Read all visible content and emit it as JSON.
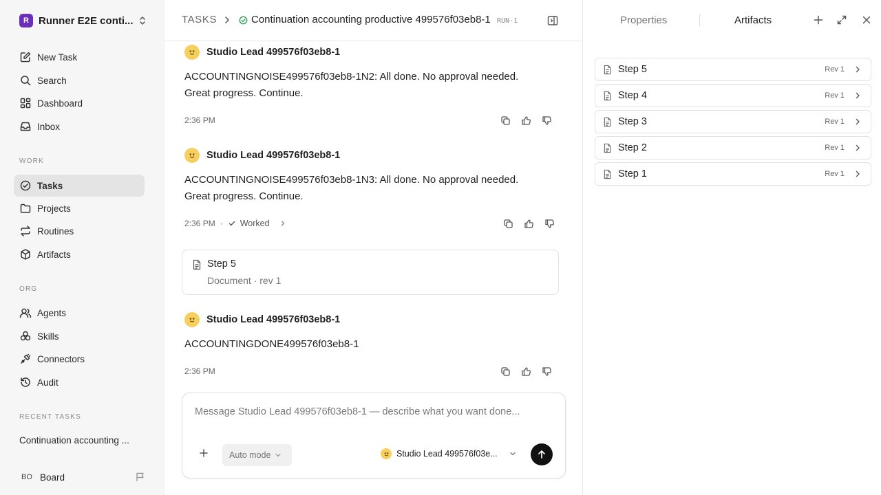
{
  "sidebar": {
    "workspace": {
      "logo_letter": "R",
      "name": "Runner E2E conti..."
    },
    "primary": [
      {
        "label": "New Task",
        "icon": "pencil-square-icon"
      },
      {
        "label": "Search",
        "icon": "search-icon"
      },
      {
        "label": "Dashboard",
        "icon": "grid-icon"
      },
      {
        "label": "Inbox",
        "icon": "inbox-icon"
      }
    ],
    "work_label": "WORK",
    "work": [
      {
        "label": "Tasks",
        "icon": "check-circle-icon",
        "active": true
      },
      {
        "label": "Projects",
        "icon": "folder-icon"
      },
      {
        "label": "Routines",
        "icon": "repeat-icon"
      },
      {
        "label": "Artifacts",
        "icon": "box-icon"
      }
    ],
    "org_label": "ORG",
    "org": [
      {
        "label": "Agents",
        "icon": "users-icon"
      },
      {
        "label": "Skills",
        "icon": "skills-icon"
      },
      {
        "label": "Connectors",
        "icon": "plug-icon"
      },
      {
        "label": "Audit",
        "icon": "history-icon"
      }
    ],
    "recent_label": "RECENT TASKS",
    "recent": [
      "Continuation accounting ..."
    ],
    "board": {
      "initials": "BO",
      "label": "Board"
    }
  },
  "header": {
    "crumb": "TASKS",
    "title": "Continuation accounting productive 499576f03eb8-1",
    "run_tag": "RUN-1"
  },
  "feed": {
    "messages": [
      {
        "author": "Studio Lead 499576f03eb8-1",
        "lines": [
          "ACCOUNTINGNOISE499576f03eb8-1N2: All done. No approval needed.",
          "Great progress. Continue."
        ],
        "time": "2:36 PM"
      },
      {
        "author": "Studio Lead 499576f03eb8-1",
        "lines": [
          "ACCOUNTINGNOISE499576f03eb8-1N3: All done. No approval needed.",
          "Great progress. Continue."
        ],
        "time": "2:36 PM",
        "status": "Worked"
      },
      {
        "author": "Studio Lead 499576f03eb8-1",
        "lines": [
          "ACCOUNTINGDONE499576f03eb8-1"
        ],
        "time": "2:36 PM"
      }
    ],
    "artifact_card": {
      "title": "Step 5",
      "subtitle": "Document · rev 1"
    }
  },
  "composer": {
    "placeholder": "Message Studio Lead 499576f03eb8-1 — describe what you want done...",
    "mode": "Auto mode",
    "agent": "Studio Lead 499576f03e..."
  },
  "panel": {
    "tabs": [
      "Properties",
      "Artifacts"
    ],
    "active_tab": "Artifacts",
    "artifacts": [
      {
        "name": "Step 5",
        "rev": "Rev 1"
      },
      {
        "name": "Step 4",
        "rev": "Rev 1"
      },
      {
        "name": "Step 3",
        "rev": "Rev 1"
      },
      {
        "name": "Step 2",
        "rev": "Rev 1"
      },
      {
        "name": "Step 1",
        "rev": "Rev 1"
      }
    ]
  },
  "colors": {
    "brand": "#6b2fb9",
    "status_green": "#2e9e4f",
    "avatar": "#f7cf5e",
    "send": "#111111"
  }
}
